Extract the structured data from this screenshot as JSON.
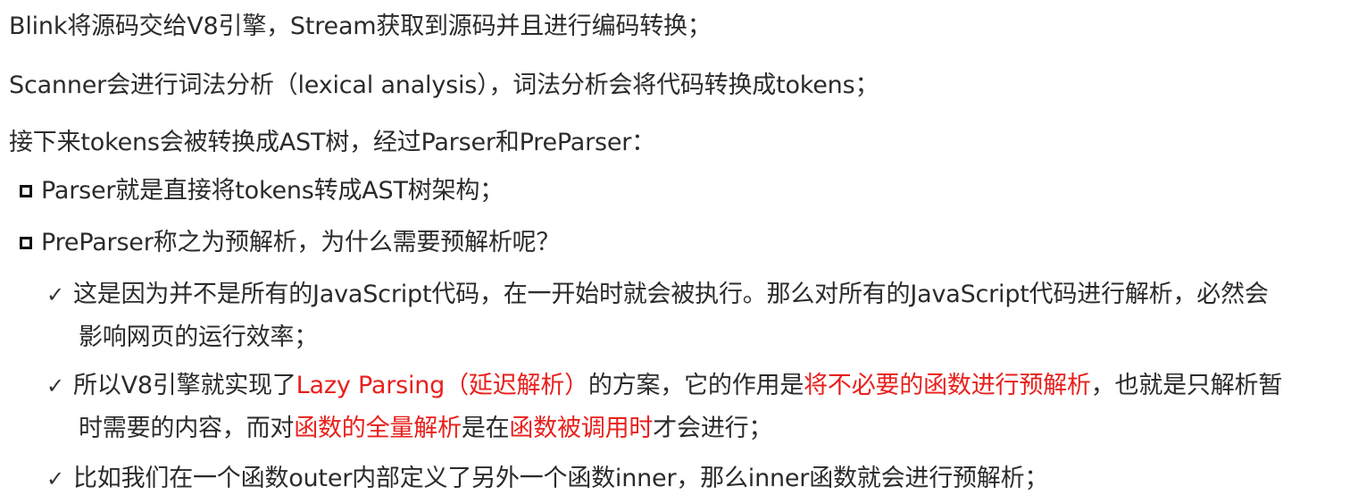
{
  "lines": {
    "l1": "Blink将源码交给V8引擎，Stream获取到源码并且进行编码转换；",
    "l2": "Scanner会进行词法分析（lexical analysis），词法分析会将代码转换成tokens；",
    "l3": "接下来tokens会被转换成AST树，经过Parser和PreParser：",
    "l4": "Parser就是直接将tokens转成AST树架构；",
    "l5": "PreParser称之为预解析，为什么需要预解析呢？",
    "l6": "这是因为并不是所有的JavaScript代码，在一开始时就会被执行。那么对所有的JavaScript代码进行解析，必然会",
    "l6b": "影响网页的运行效率；",
    "l7": {
      "a": "所以V8引擎就实现了",
      "b": "Lazy Parsing（延迟解析）",
      "c": "的方案，它的作用是",
      "d": "将不必要的函数进行预解析",
      "e": "，也就是只解析暂"
    },
    "l7b": {
      "a": "时需要的内容，而对",
      "b": "函数的全量解析",
      "c": "是在",
      "d": "函数被调用时",
      "e": "才会进行；"
    },
    "l8": "比如我们在一个函数outer内部定义了另外一个函数inner，那么inner函数就会进行预解析；"
  },
  "icons": {
    "bullet": "hollow-square-icon",
    "check": "✓"
  },
  "colors": {
    "text": "#2b2b2b",
    "highlight": "#e8201c"
  }
}
